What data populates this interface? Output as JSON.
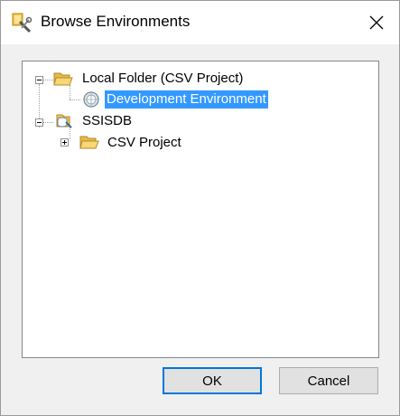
{
  "window": {
    "title": "Browse Environments"
  },
  "tree": {
    "nodes": [
      {
        "label": "Local Folder (CSV Project)"
      },
      {
        "label": "Development Environment"
      },
      {
        "label": "SSISDB"
      },
      {
        "label": "CSV Project"
      }
    ]
  },
  "buttons": {
    "ok": "OK",
    "cancel": "Cancel"
  },
  "colors": {
    "selection": "#3399ff",
    "default_button_border": "#0078d7",
    "folder": "#f8d775"
  }
}
